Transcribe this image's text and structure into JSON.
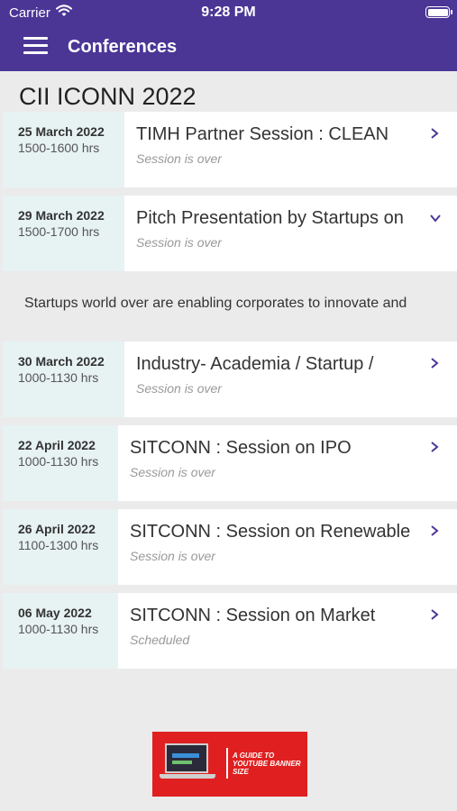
{
  "status_bar": {
    "carrier": "Carrier",
    "time": "9:28 PM"
  },
  "nav": {
    "title": "Conferences",
    "menu_icon": "hamburger-menu-icon"
  },
  "event": {
    "title": "CII ICONN 2022"
  },
  "sessions": [
    {
      "date": "25 March 2022",
      "time": "1500-1600 hrs",
      "title": "TIMH Partner Session : CLEAN",
      "status": "Session is over",
      "chevron": "chevron-right-icon"
    },
    {
      "date": "29 March 2022",
      "time": "1500-1700 hrs",
      "title": "Pitch Presentation by Startups on",
      "status": "Session is over",
      "chevron": "chevron-down-icon",
      "expanded": true
    },
    {
      "date": "30 March 2022",
      "time": "1000-1130 hrs",
      "title": "Industry- Academia / Startup /",
      "status": "Session is over",
      "chevron": "chevron-right-icon"
    },
    {
      "date": "22 April 2022",
      "time": "1000-1130 hrs",
      "title": "SITCONN : Session on IPO",
      "status": "Session is over",
      "chevron": "chevron-right-icon"
    },
    {
      "date": "26 April 2022",
      "time": "1100-1300 hrs",
      "title": "SITCONN : Session on Renewable",
      "status": "Session is over",
      "chevron": "chevron-right-icon"
    },
    {
      "date": "06 May 2022",
      "time": "1000-1130 hrs",
      "title": "SITCONN : Session on Market",
      "status": "Scheduled",
      "chevron": "chevron-right-icon"
    }
  ],
  "expanded_description": "Startups world over are enabling corporates to innovate and",
  "ad": {
    "text": "A GUIDE TO YOUTUBE BANNER SIZE"
  },
  "colors": {
    "nav_bg": "#4b3696",
    "accent": "#4b3696",
    "date_bg": "#e7f2f2",
    "page_bg": "#ebebeb",
    "ad_bg": "#e02020"
  }
}
